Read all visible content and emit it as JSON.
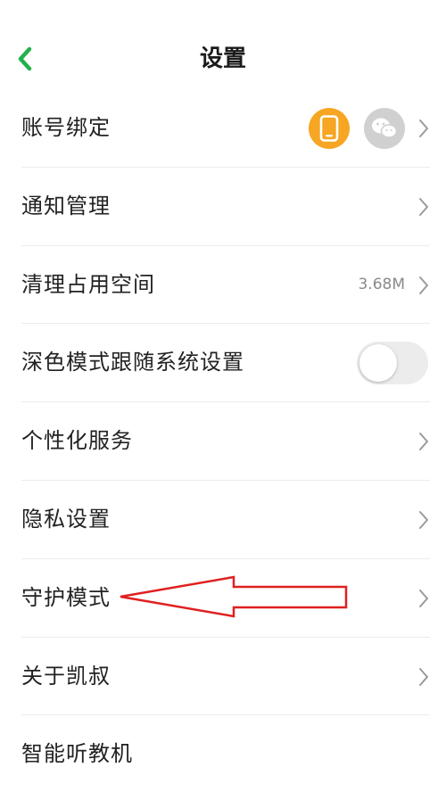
{
  "header": {
    "title": "设置"
  },
  "rows": [
    {
      "label": "账号绑定"
    },
    {
      "label": "通知管理"
    },
    {
      "label": "清理占用空间",
      "value": "3.68M"
    },
    {
      "label": "深色模式跟随系统设置",
      "toggle_on": false
    },
    {
      "label": "个性化服务"
    },
    {
      "label": "隐私设置"
    },
    {
      "label": "守护模式"
    },
    {
      "label": "关于凯叔"
    },
    {
      "label": "智能听教机"
    }
  ],
  "colors": {
    "accent_green": "#22b14c",
    "phone_badge": "#f6a623",
    "wechat_badge": "#d0d0d0",
    "annotation_red": "#e02020"
  },
  "icons": {
    "back": "chevron-left-icon",
    "phone": "phone-icon",
    "wechat": "wechat-icon",
    "chevron": "chevron-right-icon"
  }
}
